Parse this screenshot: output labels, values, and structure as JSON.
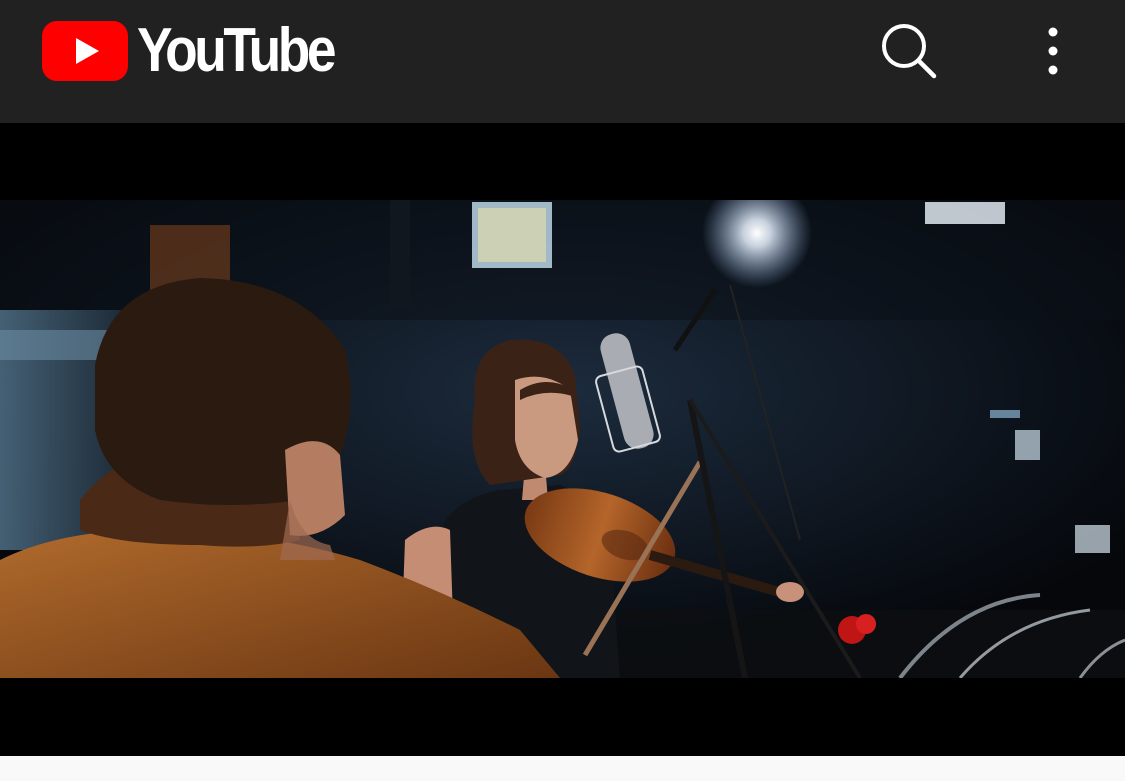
{
  "app": {
    "logo_text": "YouTube",
    "logo_icon": "youtube-play-icon",
    "brand_color": "#ff0000",
    "bar_color": "#212121"
  },
  "toolbar": {
    "search_icon": "search-icon",
    "menu_icon": "more-vert-icon"
  },
  "player": {
    "background": "#000000",
    "scene": "video-frame-violinist"
  }
}
